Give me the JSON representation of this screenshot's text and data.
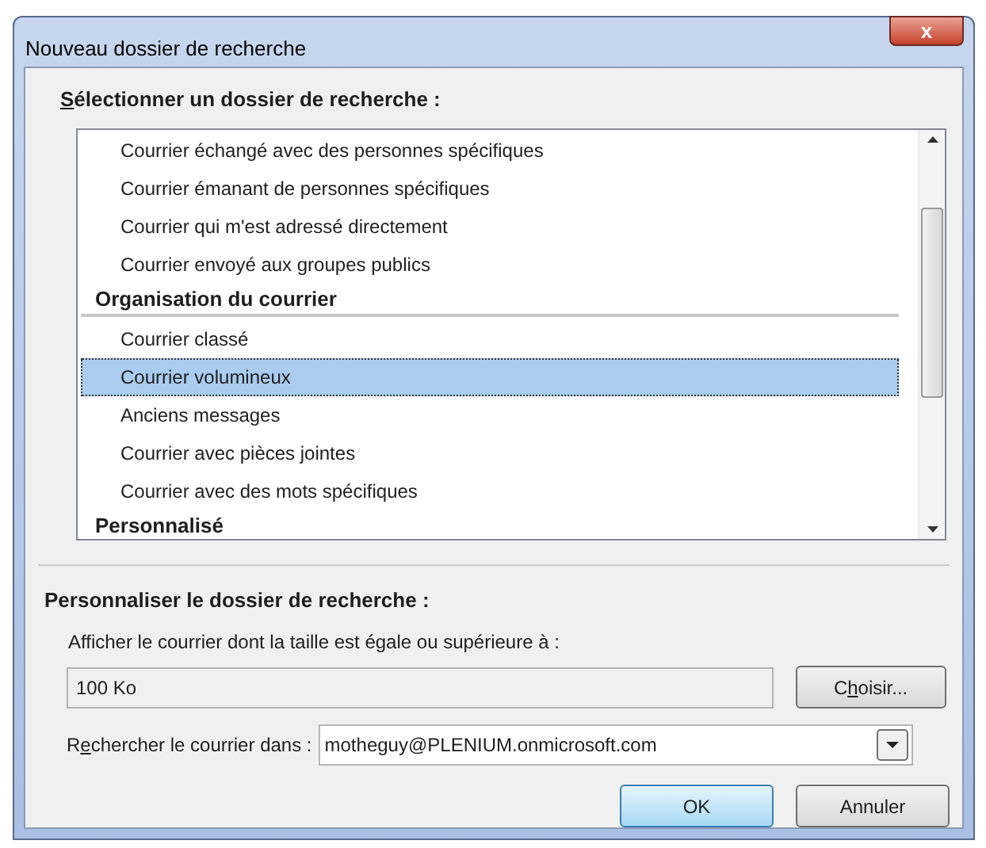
{
  "window": {
    "title": "Nouveau dossier de recherche",
    "close_symbol": "x"
  },
  "select_section": {
    "label": {
      "key": "S",
      "after": "électionner un dossier de recherche :"
    },
    "items": [
      {
        "kind": "item",
        "label": "Courrier échangé avec des personnes spécifiques",
        "selected": false
      },
      {
        "kind": "item",
        "label": "Courrier émanant de personnes spécifiques",
        "selected": false
      },
      {
        "kind": "item",
        "label": "Courrier qui m'est adressé directement",
        "selected": false
      },
      {
        "kind": "item",
        "label": "Courrier envoyé aux groupes publics",
        "selected": false
      },
      {
        "kind": "group",
        "label": "Organisation du courrier"
      },
      {
        "kind": "item",
        "label": "Courrier classé",
        "selected": false
      },
      {
        "kind": "item",
        "label": "Courrier volumineux",
        "selected": true
      },
      {
        "kind": "item",
        "label": "Anciens messages",
        "selected": false
      },
      {
        "kind": "item",
        "label": "Courrier avec pièces jointes",
        "selected": false
      },
      {
        "kind": "item",
        "label": "Courrier avec des mots spécifiques",
        "selected": false
      },
      {
        "kind": "group",
        "label": "Personnalisé"
      }
    ]
  },
  "customize_section": {
    "label": "Personnaliser le dossier de recherche :",
    "size_label": "Afficher le courrier dont la taille est égale ou supérieure à :",
    "size_value": "100 Ko",
    "choose_button": {
      "before": "C",
      "key": "h",
      "after": "oisir..."
    },
    "search_in_label": {
      "before": "R",
      "key": "e",
      "after": "chercher le courrier dans :"
    },
    "search_in_value": "motheguy@PLENIUM.onmicrosoft.com"
  },
  "buttons": [
    {
      "label": "OK",
      "default": true
    },
    {
      "label": "Annuler",
      "default": false
    }
  ]
}
